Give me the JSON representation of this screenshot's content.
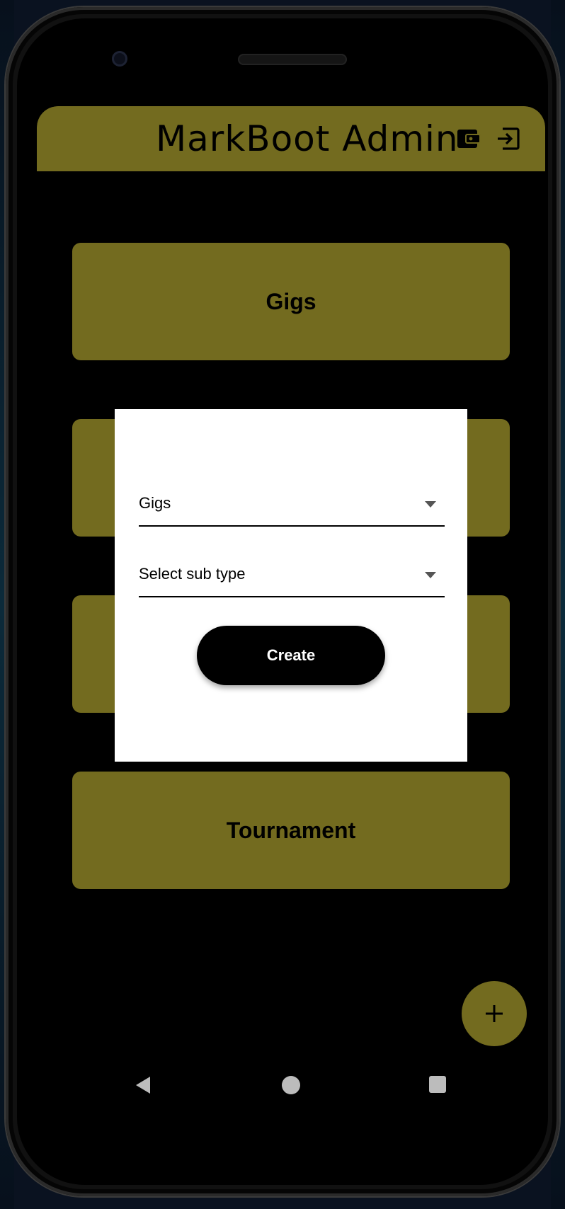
{
  "appbar": {
    "title": "MarkBoot Admin",
    "icons": [
      "wallet-icon",
      "logout-icon"
    ]
  },
  "cards": [
    {
      "label": "Gigs"
    },
    {
      "label": ""
    },
    {
      "label": ""
    },
    {
      "label": "Tournament"
    }
  ],
  "dialog": {
    "type_dropdown": {
      "value": "Gigs"
    },
    "subtype_dropdown": {
      "value": "Select sub type"
    },
    "create_label": "Create"
  },
  "fab": {
    "icon": "plus-icon"
  },
  "navbar": {
    "icons": [
      "back-icon",
      "home-icon",
      "recents-icon"
    ]
  },
  "colors": {
    "accent": "#736b1f",
    "background": "#000000",
    "dialog": "#ffffff"
  }
}
